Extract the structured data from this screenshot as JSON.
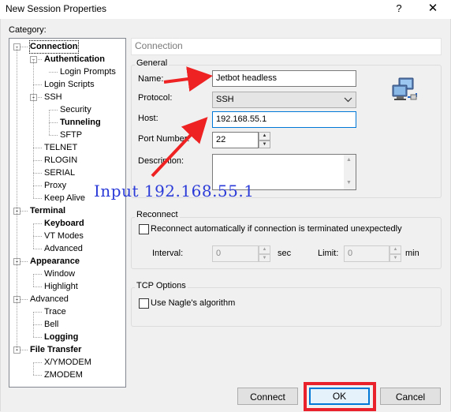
{
  "window": {
    "title": "New Session Properties",
    "help": "?",
    "close": "✕"
  },
  "category_label": "Category:",
  "tree": [
    {
      "label": "Connection",
      "level": 0,
      "bold": true,
      "selected": true,
      "expander": "-"
    },
    {
      "label": "Authentication",
      "level": 1,
      "bold": true,
      "expander": "-"
    },
    {
      "label": "Login Prompts",
      "level": 2
    },
    {
      "label": "Login Scripts",
      "level": 1
    },
    {
      "label": "SSH",
      "level": 1,
      "expander": "-"
    },
    {
      "label": "Security",
      "level": 2
    },
    {
      "label": "Tunneling",
      "level": 2,
      "bold": true
    },
    {
      "label": "SFTP",
      "level": 2
    },
    {
      "label": "TELNET",
      "level": 1
    },
    {
      "label": "RLOGIN",
      "level": 1
    },
    {
      "label": "SERIAL",
      "level": 1
    },
    {
      "label": "Proxy",
      "level": 1
    },
    {
      "label": "Keep Alive",
      "level": 1
    },
    {
      "label": "Terminal",
      "level": 0,
      "bold": true,
      "expander": "-"
    },
    {
      "label": "Keyboard",
      "level": 1,
      "bold": true
    },
    {
      "label": "VT Modes",
      "level": 1
    },
    {
      "label": "Advanced",
      "level": 1
    },
    {
      "label": "Appearance",
      "level": 0,
      "bold": true,
      "expander": "-"
    },
    {
      "label": "Window",
      "level": 1
    },
    {
      "label": "Highlight",
      "level": 1
    },
    {
      "label": "Advanced",
      "level": 0,
      "expander": "-"
    },
    {
      "label": "Trace",
      "level": 1
    },
    {
      "label": "Bell",
      "level": 1
    },
    {
      "label": "Logging",
      "level": 1,
      "bold": true
    },
    {
      "label": "File Transfer",
      "level": 0,
      "bold": true,
      "expander": "-"
    },
    {
      "label": "X/YMODEM",
      "level": 1
    },
    {
      "label": "ZMODEM",
      "level": 1
    }
  ],
  "panel_title": "Connection",
  "general": {
    "label": "General",
    "name_label": "Name:",
    "name_value": "Jetbot headless",
    "protocol_label": "Protocol:",
    "protocol_value": "SSH",
    "host_label": "Host:",
    "host_value": "192.168.55.1",
    "port_label": "Port Number:",
    "port_value": "22",
    "description_label": "Description:",
    "description_value": ""
  },
  "reconnect": {
    "label": "Reconnect",
    "checkbox_label": "Reconnect automatically if connection is terminated unexpectedly",
    "checked": false,
    "interval_label": "Interval:",
    "interval_value": "0",
    "interval_unit": "sec",
    "limit_label": "Limit:",
    "limit_value": "0",
    "limit_unit": "min"
  },
  "tcp": {
    "label": "TCP Options",
    "checkbox_label": "Use Nagle's algorithm",
    "checked": false
  },
  "buttons": {
    "connect": "Connect",
    "ok": "OK",
    "cancel": "Cancel"
  },
  "annotation": "Input 192.168.55.1",
  "colors": {
    "annotation_arrow": "#ee2222",
    "annotation_text": "#2b3bd8",
    "highlight_box": "#e8212b"
  },
  "icons": {
    "network": "network-computers-icon",
    "dropdown": "chevron-down-icon"
  }
}
